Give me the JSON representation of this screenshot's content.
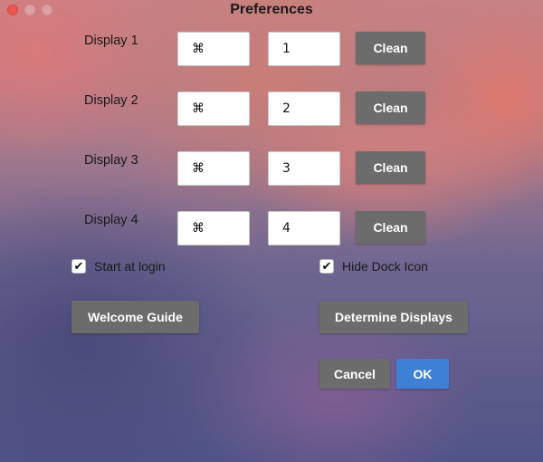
{
  "window": {
    "title": "Preferences"
  },
  "displays": [
    {
      "label": "Display 1",
      "modifier": "⌘",
      "key": "1",
      "clean_label": "Clean"
    },
    {
      "label": "Display 2",
      "modifier": "⌘",
      "key": "2",
      "clean_label": "Clean"
    },
    {
      "label": "Display 3",
      "modifier": "⌘",
      "key": "3",
      "clean_label": "Clean"
    },
    {
      "label": "Display 4",
      "modifier": "⌘",
      "key": "4",
      "clean_label": "Clean"
    }
  ],
  "options": {
    "start_at_login": {
      "label": "Start at login",
      "checked": true,
      "mark": "✔"
    },
    "hide_dock_icon": {
      "label": "Hide Dock Icon",
      "checked": true,
      "mark": "✔"
    }
  },
  "buttons": {
    "welcome_guide": "Welcome Guide",
    "determine_displays": "Determine Displays",
    "cancel": "Cancel",
    "ok": "OK"
  },
  "colors": {
    "close_button": "#f0544f",
    "primary_button": "#3f80d7",
    "secondary_button": "#6c6c6c"
  }
}
